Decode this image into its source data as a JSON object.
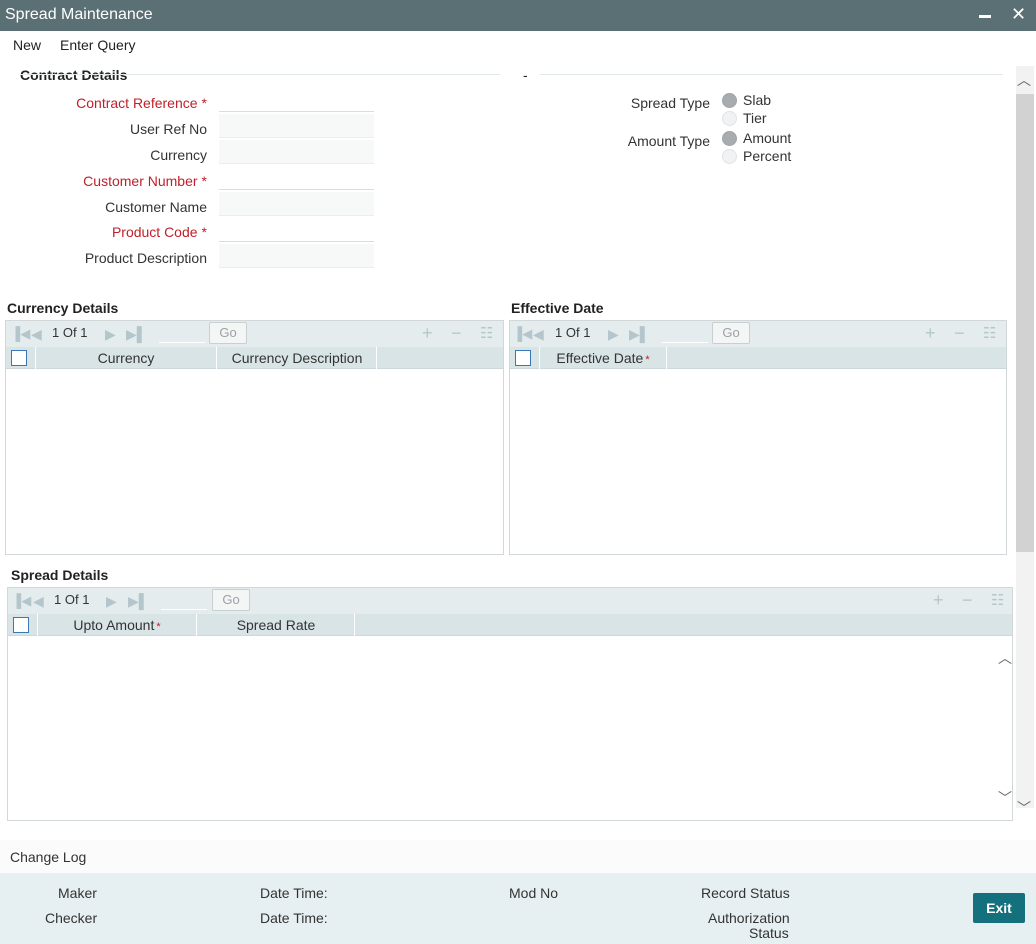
{
  "window": {
    "title": "Spread Maintenance"
  },
  "menu": {
    "new": "New",
    "enter_query": "Enter Query"
  },
  "contract": {
    "title": "Contract Details",
    "right_title": "-",
    "fields": {
      "contract_reference": {
        "label": "Contract Reference",
        "value": ""
      },
      "user_ref_no": {
        "label": "User Ref No",
        "value": ""
      },
      "currency": {
        "label": "Currency",
        "value": ""
      },
      "customer_number": {
        "label": "Customer Number",
        "value": ""
      },
      "customer_name": {
        "label": "Customer Name",
        "value": ""
      },
      "product_code": {
        "label": "Product Code",
        "value": ""
      },
      "product_description": {
        "label": "Product Description",
        "value": ""
      }
    },
    "required_mark": "*",
    "spread_type": {
      "label": "Spread Type",
      "options": [
        "Slab",
        "Tier"
      ],
      "selected": "Slab"
    },
    "amount_type": {
      "label": "Amount Type",
      "options": [
        "Amount",
        "Percent"
      ],
      "selected": "Amount"
    }
  },
  "currency_details": {
    "title": "Currency Details",
    "pager": {
      "page": "1",
      "of": "Of",
      "total": "1",
      "go": "Go"
    },
    "columns": [
      "Currency",
      "Currency Description"
    ]
  },
  "effective_date": {
    "title": "Effective Date",
    "pager": {
      "page": "1",
      "of": "Of",
      "total": "1",
      "go": "Go"
    },
    "columns": [
      "Effective Date"
    ]
  },
  "spread_details": {
    "title": "Spread Details",
    "pager": {
      "page": "1",
      "of": "Of",
      "total": "1",
      "go": "Go"
    },
    "columns": [
      "Upto Amount",
      "Spread Rate"
    ]
  },
  "changelog": {
    "title": "Change Log"
  },
  "footer": {
    "maker": "Maker",
    "checker": "Checker",
    "date_time_1": "Date Time:",
    "date_time_2": "Date Time:",
    "mod_no": "Mod No",
    "record_status": "Record Status",
    "authorization": "Authorization",
    "status": "Status",
    "exit": "Exit"
  },
  "icons": {
    "first": "first-page-icon",
    "prev": "prev-page-icon",
    "next": "next-page-icon",
    "last": "last-page-icon",
    "add": "add-row-icon",
    "delete": "delete-row-icon",
    "view": "single-view-icon"
  }
}
